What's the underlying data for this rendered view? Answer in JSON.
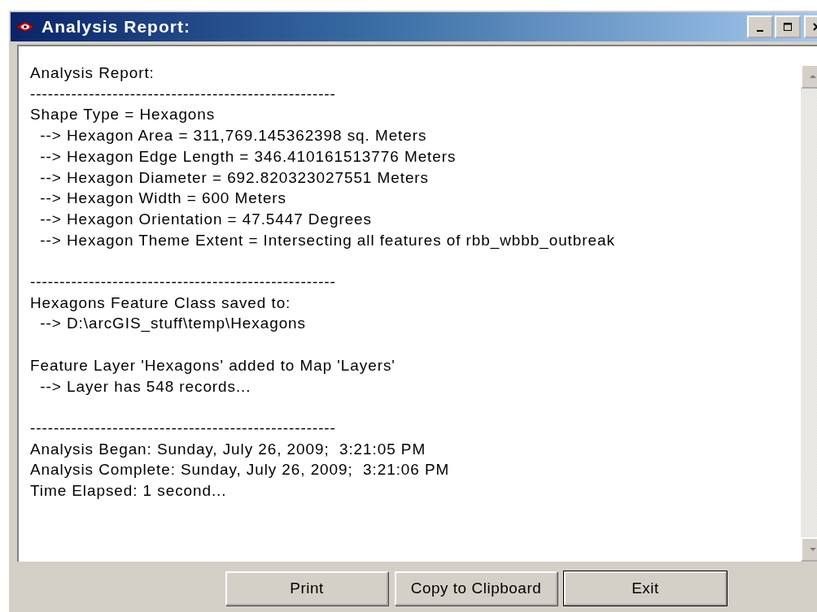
{
  "window": {
    "title": "Analysis Report:"
  },
  "report_paragraphs": [
    {
      "lines": [
        "Analysis Report:",
        "----------------------------------------------------",
        "Shape Type = Hexagons",
        "  --> Hexagon Area = 311,769.145362398 sq. Meters",
        "  --> Hexagon Edge Length = 346.410161513776 Meters",
        "  --> Hexagon Diameter = 692.820323027551 Meters",
        "  --> Hexagon Width = 600 Meters",
        "  --> Hexagon Orientation = 47.5447 Degrees",
        "  --> Hexagon Theme Extent = Intersecting all features of rbb_wbbb_outbreak"
      ]
    },
    {
      "lines": [
        "----------------------------------------------------",
        "Hexagons Feature Class saved to:",
        "  --> D:\\arcGIS_stuff\\temp\\Hexagons"
      ]
    },
    {
      "lines": [
        "Feature Layer 'Hexagons' added to Map 'Layers'",
        "  --> Layer has 548 records..."
      ]
    },
    {
      "lines": [
        "----------------------------------------------------",
        "Analysis Began: Sunday, July 26, 2009;  3:21:05 PM",
        "Analysis Complete: Sunday, July 26, 2009;  3:21:06 PM",
        "Time Elapsed: 1 second..."
      ]
    }
  ],
  "buttons": [
    {
      "label": "Print",
      "default": false
    },
    {
      "label": "Copy to Clipboard",
      "default": false
    },
    {
      "label": "Exit",
      "default": true
    }
  ]
}
